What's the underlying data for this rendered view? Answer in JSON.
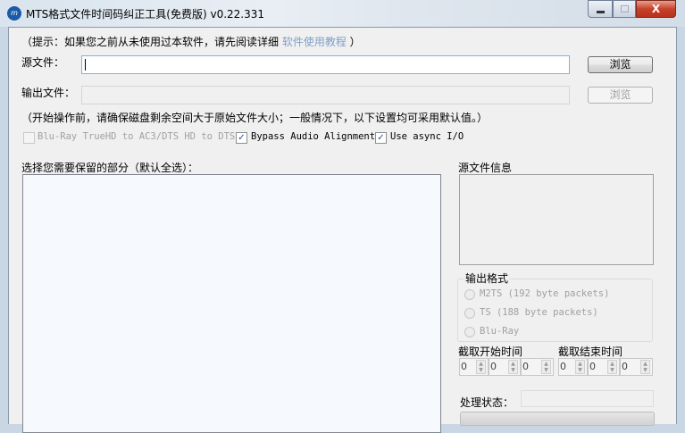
{
  "window": {
    "title": "MTS格式文件时间码纠正工具(免费版) v0.22.331",
    "icon_text": "m",
    "close_glyph": "X"
  },
  "hint": {
    "prefix": "（提示：如果您之前从未使用过本软件，请先阅读详细 ",
    "link": "软件使用教程",
    "suffix": " ）"
  },
  "source": {
    "label": "源文件：",
    "value": "",
    "browse": "浏览"
  },
  "output": {
    "label": "输出文件：",
    "value": "",
    "browse": "浏览"
  },
  "note": "（开始操作前，请确保磁盘剩余空间大于原始文件大小；一般情况下，以下设置均可采用默认值。）",
  "options": [
    {
      "label": "Blu-Ray TrueHD to AC3/DTS HD to DTS",
      "checked": false,
      "enabled": false
    },
    {
      "label": "Bypass Audio Alignment",
      "checked": true,
      "enabled": true
    },
    {
      "label": "Use async I/O",
      "checked": true,
      "enabled": true
    }
  ],
  "check_glyph": "✓",
  "parts_label": "选择您需要保留的部分（默认全选）：",
  "info_label": "源文件信息",
  "format": {
    "legend": "输出格式",
    "options": [
      "M2TS (192 byte packets)",
      "TS (188 byte packets)",
      "Blu-Ray"
    ]
  },
  "start_label": "截取开始时间",
  "end_label": "截取结束时间",
  "start_values": [
    "0",
    "0",
    "0"
  ],
  "end_values": [
    "0",
    "0",
    "0"
  ],
  "status_label": "处理状态：",
  "status_value": ""
}
